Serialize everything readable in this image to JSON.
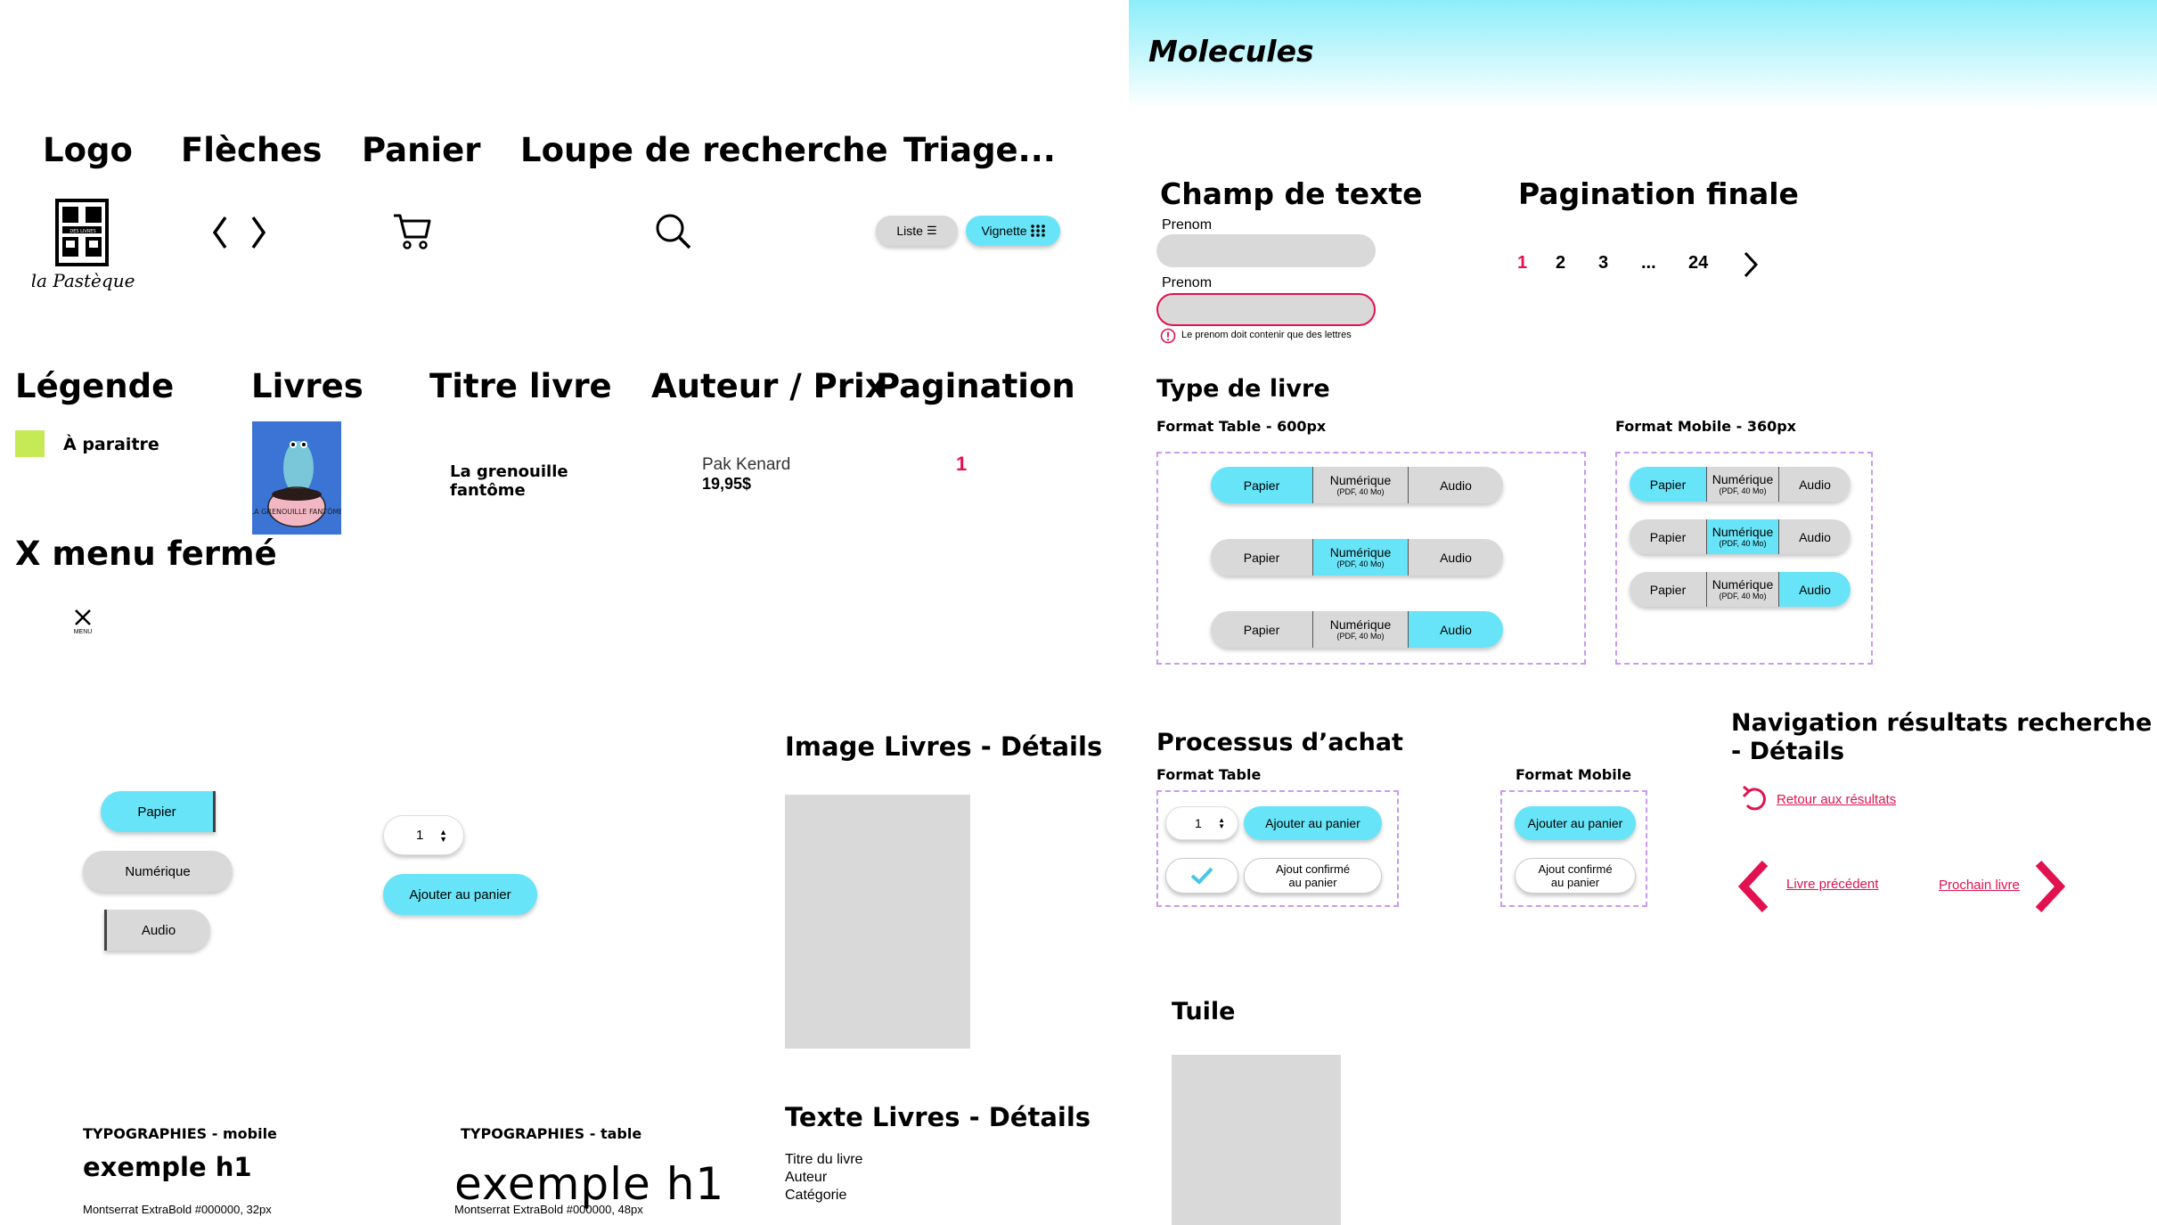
{
  "atoms": {
    "logo_heading": "Logo",
    "arrows_heading": "Flèches",
    "cart_heading": "Panier",
    "search_heading": "Loupe de recherche",
    "sort_heading": "Triage...",
    "sort_list_label": "Liste",
    "sort_grid_label": "Vignette",
    "logo_text_top": "DES LIVRES",
    "logo_script": "la Pastèque",
    "legend_heading": "Légende",
    "legend_label": "À paraitre",
    "legend_color": "#c5ea55",
    "books_heading": "Livres",
    "book_cover_text": "LA GRENOUILLE FANTÔME",
    "book_title_heading": "Titre livre",
    "book_title": "La grenouille fantôme",
    "author_price_heading": "Auteur / Prix",
    "author": "Pak Kenard",
    "price": "19,95$",
    "pagination_heading": "Pagination",
    "pagination_value": "1",
    "menu_heading": "X menu fermé",
    "menu_label": "MENU"
  },
  "buttons": {
    "papier": "Papier",
    "numerique": "Numérique",
    "audio": "Audio",
    "quantity": "1",
    "add_to_cart": "Ajouter au panier"
  },
  "image_details": {
    "heading": "Image Livres - Détails"
  },
  "text_details": {
    "heading": "Texte Livres - Détails",
    "lines": [
      "Titre du livre",
      "Auteur",
      "Catégorie"
    ]
  },
  "typography": {
    "mobile_label": "TYPOGRAPHIES - mobile",
    "mobile_example": "exemple h1",
    "mobile_spec": "Montserrat ExtraBold #000000, 32px",
    "table_label": "TYPOGRAPHIES - table",
    "table_example": "exemple h1",
    "table_spec": "Montserrat ExtraBold #000000, 48px"
  },
  "molecules": {
    "title": "Molecules",
    "text_field": {
      "heading": "Champ de texte",
      "label1": "Prenom",
      "label2": "Prenom",
      "error": "Le prenom doit contenir que des lettres"
    },
    "pagination": {
      "heading": "Pagination finale",
      "pages": [
        "1",
        "2",
        "3",
        "...",
        "24"
      ]
    },
    "book_type": {
      "heading": "Type de livre",
      "table_label": "Format Table - 600px",
      "mobile_label": "Format Mobile - 360px",
      "papier": "Papier",
      "numerique": "Numérique",
      "numerique_sub": "(PDF, 40 Mo)",
      "audio": "Audio"
    },
    "purchase": {
      "heading": "Processus d’achat",
      "table_label": "Format Table",
      "mobile_label": "Format Mobile",
      "quantity": "1",
      "add": "Ajouter au panier",
      "confirmed_1": "Ajout confirmé",
      "confirmed_2": "au panier"
    },
    "navigation": {
      "heading_1": "Navigation résultats recherche",
      "heading_2": "- Détails",
      "back": "Retour aux résultats",
      "prev": "Livre précédent",
      "next": "Prochain livre"
    },
    "tile": {
      "heading": "Tuile"
    }
  },
  "colors": {
    "accent_cyan": "#67e4f7",
    "accent_pink": "#e1124f",
    "placeholder_grey": "#d9d9d9",
    "dashed_purple": "#c89af0"
  }
}
